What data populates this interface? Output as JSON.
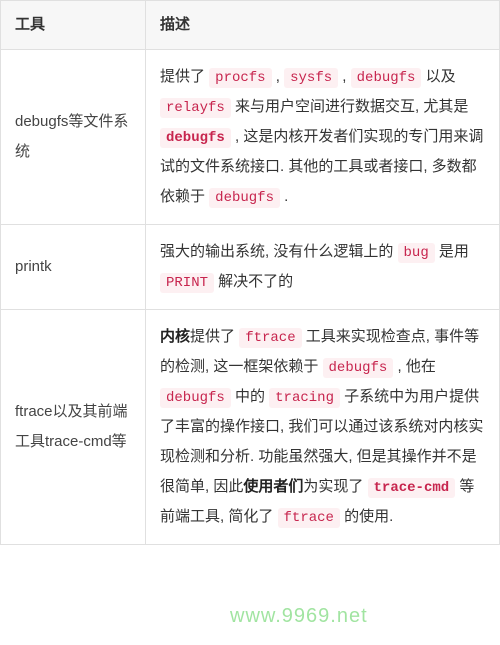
{
  "table": {
    "headers": {
      "tool": "工具",
      "desc": "描述"
    },
    "rows": [
      {
        "tool": "debugfs等文件系统",
        "desc": {
          "t0": "提供了 ",
          "c0": "procfs",
          "t1": " , ",
          "c1": "sysfs",
          "t2": " , ",
          "c2": "debugfs",
          "t3": " 以及 ",
          "c3": "relayfs",
          "t4": " 来与用户空间进行数据交互, 尤其是 ",
          "c4": "debugfs",
          "t5": " , 这是内核开发者们实现的专门用来调试的文件系统接口. 其他的工具或者接口, 多数都依赖于 ",
          "c5": "debugfs",
          "t6": " ."
        }
      },
      {
        "tool": "printk",
        "desc": {
          "t0": "强大的输出系统, 没有什么逻辑上的 ",
          "c0": "bug",
          "t1": " 是用 ",
          "c1": "PRINT",
          "t2": " 解决不了的"
        }
      },
      {
        "tool": "ftrace以及其前端工具trace-cmd等",
        "desc": {
          "b0": "内核",
          "t0": "提供了 ",
          "c0": "ftrace",
          "t1": " 工具来实现检查点, 事件等的检测, 这一框架依赖于 ",
          "c1": "debugfs",
          "t2": " , 他在 ",
          "c2": "debugfs",
          "t3": " 中的 ",
          "c3": "tracing",
          "t4": " 子系统中为用户提供了丰富的操作接口, 我们可以通过该系统对内核实现检测和分析. 功能虽然强大, 但是其操作并不是很简单, 因此",
          "b1": "使用者们",
          "t5": "为实现了 ",
          "c4": "trace-cmd",
          "t6": " 等前端工具, 简化了 ",
          "c5": "ftrace",
          "t7": " 的使用."
        }
      }
    ]
  },
  "watermark": "www.9969.net"
}
